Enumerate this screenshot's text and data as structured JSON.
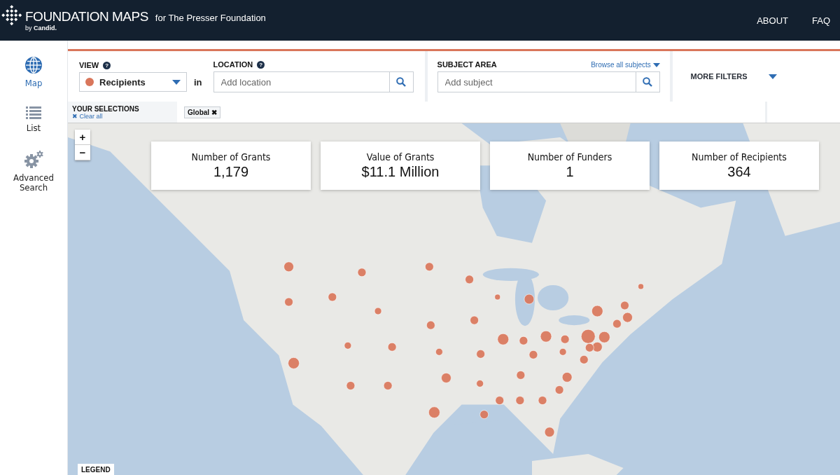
{
  "header": {
    "logo_title": "FOUNDATION MAPS",
    "logo_byline": "by",
    "logo_brand": "Candid.",
    "subtitle": "for The Presser Foundation",
    "nav": [
      {
        "label": "ABOUT"
      },
      {
        "label": "FAQ"
      }
    ]
  },
  "sidebar": {
    "items": [
      {
        "kind": "globe",
        "label": "Map",
        "selected": true
      },
      {
        "kind": "list",
        "label": "List",
        "selected": false
      },
      {
        "kind": "gears",
        "label": "Advanced Search",
        "selected": false
      }
    ]
  },
  "filters": {
    "view": {
      "label": "VIEW",
      "help": "?",
      "value": "Recipients",
      "joiner": "in"
    },
    "location": {
      "label": "LOCATION",
      "help": "?",
      "placeholder": "Add location"
    },
    "subject": {
      "label": "SUBJECT AREA",
      "browse": "Browse all subjects",
      "placeholder": "Add subject"
    },
    "more_filters": "MORE FILTERS"
  },
  "selections": {
    "label": "YOUR SELECTIONS",
    "clear": "✖ Clear all",
    "tags": [
      {
        "label": "Global",
        "remove": "✖"
      }
    ]
  },
  "map": {
    "kind": "picture",
    "zoom_in": "+",
    "zoom_out": "−",
    "legend": "LEGEND",
    "stats": [
      {
        "label": "Number of Grants",
        "value": "1,179"
      },
      {
        "label": "Value of Grants",
        "value": "$11.1 Million"
      },
      {
        "label": "Number of Funders",
        "value": "1"
      },
      {
        "label": "Number of Recipients",
        "value": "364"
      }
    ]
  }
}
